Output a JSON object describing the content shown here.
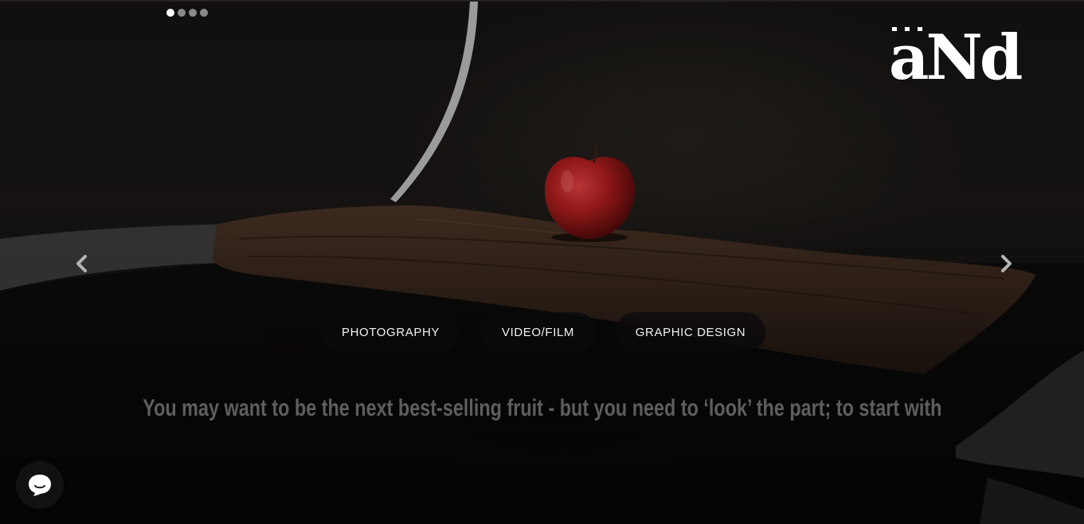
{
  "carousel": {
    "slide_count": 4,
    "active_slide": 1,
    "prev_label": "previous slide",
    "next_label": "next slide"
  },
  "logo": {
    "text": "aNd",
    "icon": "and-logo"
  },
  "categories": [
    {
      "label": "PHOTOGRAPHY"
    },
    {
      "label": "VIDEO/FILM"
    },
    {
      "label": "GRAPHIC DESIGN"
    }
  ],
  "tagline": "You may want to be the next best-selling fruit - but you need to ‘look’ the part; to start with",
  "chat": {
    "icon": "chat-bubble-icon"
  },
  "colors": {
    "pill_background": "#0a0a0a",
    "tagline": "#5e5e5e",
    "dot_active": "#ffffff",
    "dot_inactive": "#8a8a8a",
    "apple_red": "#b01e1e"
  }
}
